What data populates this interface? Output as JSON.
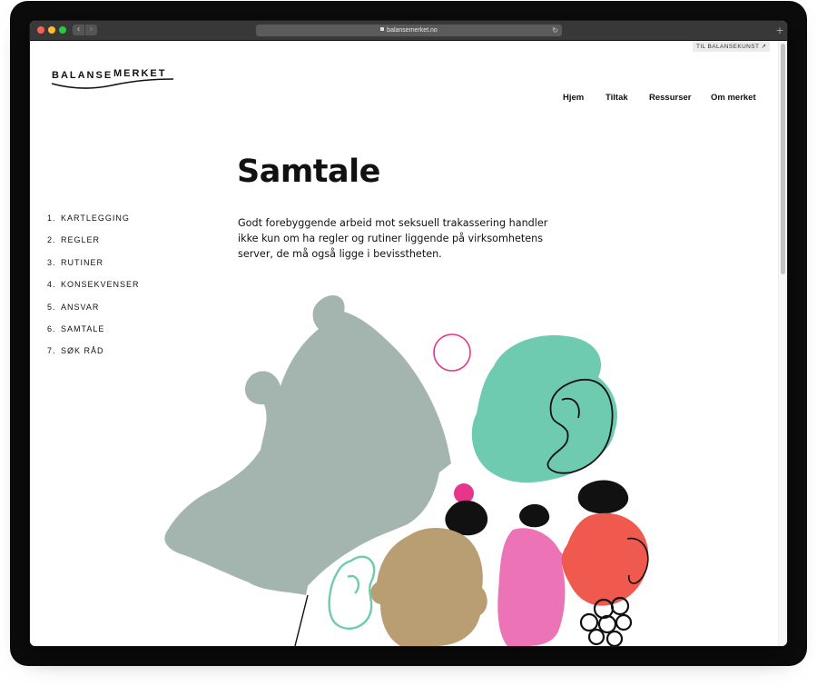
{
  "browser": {
    "url": "balansemerket.no"
  },
  "header": {
    "external_link": "TIL BALANSEKUNST ↗",
    "logo_left": "BALANSE",
    "logo_right": "MERKET",
    "nav": [
      "Hjem",
      "Tiltak",
      "Ressurser",
      "Om merket"
    ]
  },
  "main": {
    "title": "Samtale",
    "intro": "Godt forebyggende arbeid mot seksuell trakassering handler ikke kun om ha regler og rutiner liggende på virksomhetens server, de må også ligge i bevisstheten."
  },
  "toc": [
    {
      "num": "1.",
      "label": "KARTLEGGING"
    },
    {
      "num": "2.",
      "label": "REGLER"
    },
    {
      "num": "3.",
      "label": "RUTINER"
    },
    {
      "num": "4.",
      "label": "KONSEKVENSER"
    },
    {
      "num": "5.",
      "label": "ANSVAR"
    },
    {
      "num": "6.",
      "label": "SAMTALE"
    },
    {
      "num": "7.",
      "label": "SØK RÅD"
    }
  ],
  "colors": {
    "grey_green": "#9fb1ab",
    "mint": "#6fcbb0",
    "tan": "#b89e72",
    "pink": "#ec74b6",
    "coral": "#f05a4e",
    "magenta": "#e6358a",
    "black": "#111111"
  },
  "icons": [
    "lock-icon",
    "reload-icon",
    "external-link-arrow-icon"
  ]
}
